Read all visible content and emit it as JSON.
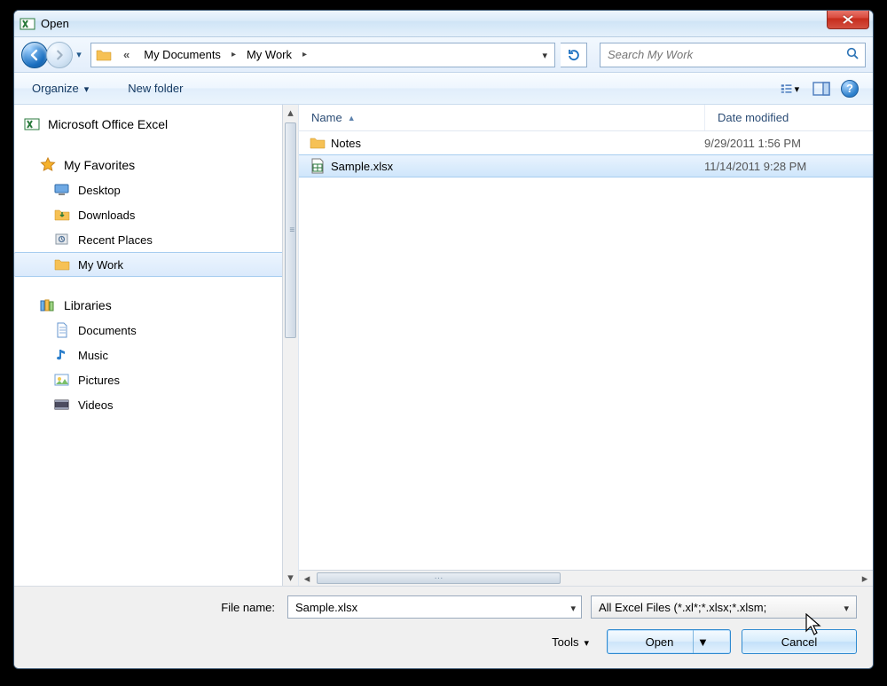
{
  "titlebar": {
    "title": "Open"
  },
  "nav": {
    "breadcrumb": {
      "overflow_marker": "«",
      "items": [
        "My Documents",
        "My Work"
      ]
    },
    "search_placeholder": "Search My Work"
  },
  "toolbar": {
    "organize_label": "Organize",
    "newfolder_label": "New folder"
  },
  "navpane": {
    "excel_root": "Microsoft Office Excel",
    "favorites_label": "My Favorites",
    "favorites": [
      {
        "label": "Desktop",
        "icon": "desktop"
      },
      {
        "label": "Downloads",
        "icon": "downloads"
      },
      {
        "label": "Recent Places",
        "icon": "recent"
      },
      {
        "label": "My Work",
        "icon": "folder",
        "selected": true
      }
    ],
    "libraries_label": "Libraries",
    "libraries": [
      {
        "label": "Documents",
        "icon": "doc"
      },
      {
        "label": "Music",
        "icon": "music"
      },
      {
        "label": "Pictures",
        "icon": "picture"
      },
      {
        "label": "Videos",
        "icon": "video"
      }
    ]
  },
  "columns": {
    "name": "Name",
    "date": "Date modified"
  },
  "files": [
    {
      "name": "Notes",
      "date": "9/29/2011 1:56 PM",
      "icon": "folder",
      "selected": false
    },
    {
      "name": "Sample.xlsx",
      "date": "11/14/2011 9:28 PM",
      "icon": "xlsx",
      "selected": true
    }
  ],
  "footer": {
    "filename_label": "File name:",
    "filename_value": "Sample.xlsx",
    "filter_label": "All Excel Files (*.xl*;*.xlsx;*.xlsm;",
    "tools_label": "Tools",
    "open_label": "Open",
    "cancel_label": "Cancel"
  }
}
